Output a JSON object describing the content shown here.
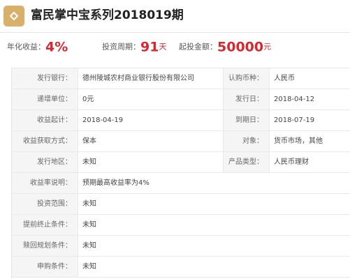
{
  "header": {
    "title": "富民掌中宝系列2018019期",
    "logo_icon": "diamond-icon",
    "logo_color": "#d8b06a"
  },
  "stats": {
    "yield_label": "年化收益：",
    "yield_value": "4%",
    "period_label": "投资周期：",
    "period_value": "91",
    "period_unit": "天",
    "min_label": "起投金额：",
    "min_value": "50000",
    "min_unit": "元",
    "accent_color": "#d7282f"
  },
  "table": {
    "rows": [
      {
        "l1": "发行银行：",
        "v1": "德州陵城农村商业银行股份有限公司",
        "l2": "认购币种：",
        "v2": "人民币"
      },
      {
        "l1": "递增单位：",
        "v1": "0元",
        "l2": "发行日：",
        "v2": "2018-04-12"
      },
      {
        "l1": "收益起计：",
        "v1": "2018-04-19",
        "l2": "到期日：",
        "v2": "2018-07-19"
      },
      {
        "l1": "收益获取方式：",
        "v1": "保本",
        "l2": "对象：",
        "v2": "货币市场，其他"
      },
      {
        "l1": "发行地区：",
        "v1": "未知",
        "l2": "产品类型：",
        "v2": "人民币理财"
      },
      {
        "l1": "收益率说明：",
        "v1": "预期最高收益率为4%"
      },
      {
        "l1": "投资范围：",
        "v1": "未知"
      },
      {
        "l1": "提前终止条件：",
        "v1": "未知"
      },
      {
        "l1": "赎回规划条件：",
        "v1": "未知"
      },
      {
        "l1": "申购条件：",
        "v1": "未知"
      }
    ]
  }
}
